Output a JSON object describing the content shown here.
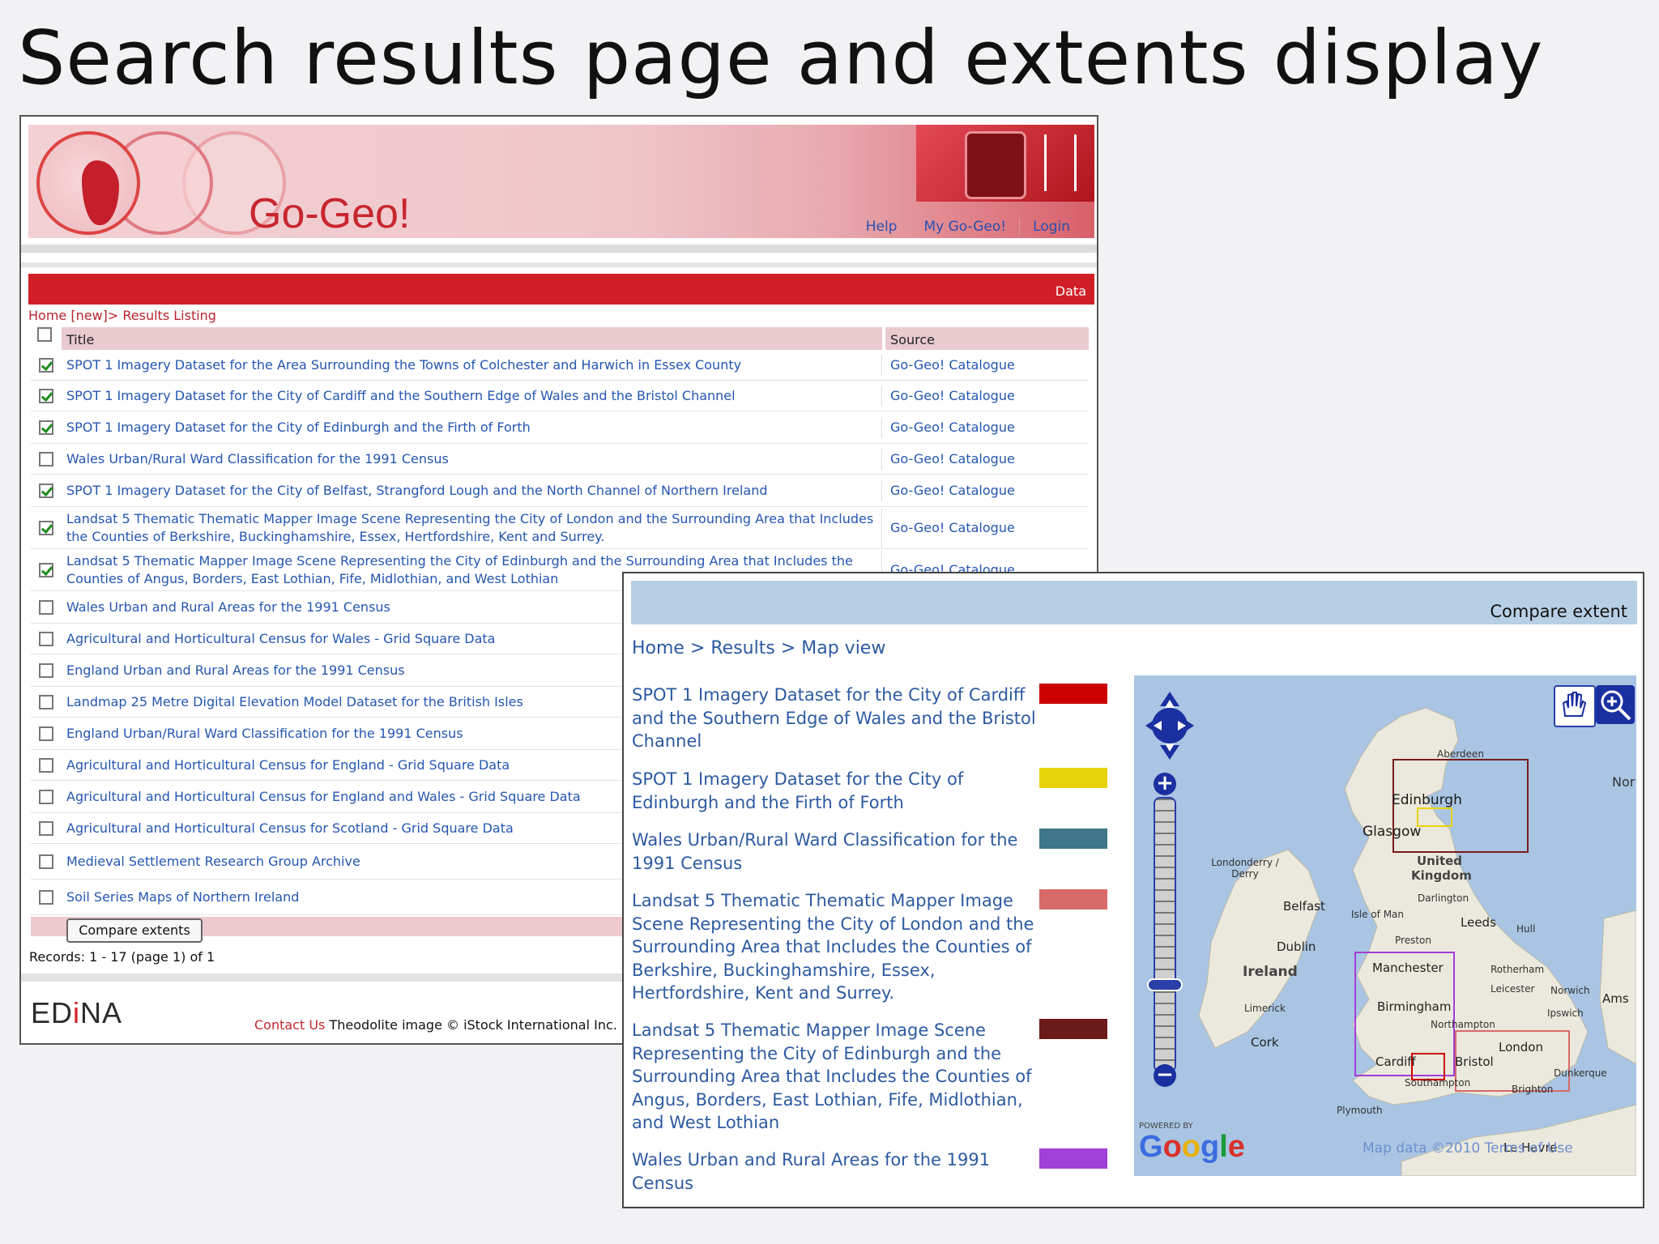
{
  "slide_title": "Search results page and extents display",
  "results_page": {
    "logo": "Go-Geo!",
    "nav": [
      "Help",
      "My Go-Geo!",
      "Login"
    ],
    "section_label": "Data",
    "breadcrumb": "Home [new]> Results Listing",
    "columns": {
      "title": "Title",
      "source": "Source"
    },
    "rows": [
      {
        "checked": true,
        "title": "SPOT 1 Imagery Dataset for the Area Surrounding the Towns of Colchester and Harwich in Essex County",
        "source": "Go-Geo! Catalogue"
      },
      {
        "checked": true,
        "title": "SPOT 1 Imagery Dataset for the City of Cardiff and the Southern Edge of Wales and the Bristol Channel",
        "source": "Go-Geo! Catalogue"
      },
      {
        "checked": true,
        "title": "SPOT 1 Imagery Dataset for the City of Edinburgh and the Firth of Forth",
        "source": "Go-Geo! Catalogue"
      },
      {
        "checked": false,
        "title": "Wales Urban/Rural Ward Classification for the 1991 Census",
        "source": "Go-Geo! Catalogue"
      },
      {
        "checked": true,
        "title": "SPOT 1 Imagery Dataset for the City of Belfast, Strangford Lough and the North Channel of Northern Ireland",
        "source": "Go-Geo! Catalogue"
      },
      {
        "checked": true,
        "title": "Landsat 5 Thematic Thematic Mapper Image Scene Representing the City of London and the Surrounding Area that Includes the Counties of Berkshire, Buckinghamshire, Essex, Hertfordshire, Kent and Surrey.",
        "source": "Go-Geo! Catalogue"
      },
      {
        "checked": true,
        "title": "Landsat 5 Thematic Mapper Image Scene Representing the City of Edinburgh and the Surrounding Area that Includes the Counties of Angus, Borders, East Lothian, Fife, Midlothian, and West Lothian",
        "source": "Go-Geo! Catalogue"
      },
      {
        "checked": false,
        "title": "Wales Urban and Rural Areas for the 1991 Census",
        "source": ""
      },
      {
        "checked": false,
        "title": "Agricultural and Horticultural Census for Wales - Grid Square Data",
        "source": ""
      },
      {
        "checked": false,
        "title": "England Urban and Rural Areas for the 1991 Census",
        "source": ""
      },
      {
        "checked": false,
        "title": "Landmap 25 Metre Digital Elevation Model Dataset for the British Isles",
        "source": ""
      },
      {
        "checked": false,
        "title": "England Urban/Rural Ward Classification for the 1991 Census",
        "source": ""
      },
      {
        "checked": false,
        "title": "Agricultural and Horticultural Census for England - Grid Square Data",
        "source": ""
      },
      {
        "checked": false,
        "title": "Agricultural and Horticultural Census for England and Wales - Grid Square Data",
        "source": ""
      },
      {
        "checked": false,
        "title": "Agricultural and Horticultural Census for Scotland - Grid Square Data",
        "source": ""
      },
      {
        "checked": false,
        "title": "Medieval Settlement Research Group Archive",
        "source": ""
      },
      {
        "checked": false,
        "title": "Soil Series Maps of Northern Ireland",
        "source": ""
      }
    ],
    "compare_button": "Compare extents",
    "records": "Records: 1 - 17 (page 1) of 1",
    "footer_logo": "EDINA",
    "contact_link": "Contact Us",
    "credit": "Theodolite image © iStock International Inc."
  },
  "compare_page": {
    "header": "Compare extent",
    "breadcrumb": "Home > Results > Map view",
    "legend": [
      {
        "label": "SPOT 1 Imagery Dataset for the City of Cardiff and the Southern Edge of Wales and the Bristol Channel",
        "color": "#cc0000"
      },
      {
        "label": "SPOT 1 Imagery Dataset for the City of Edinburgh and the Firth of Forth",
        "color": "#e8d40c"
      },
      {
        "label": "Wales Urban/Rural Ward Classification for the 1991 Census",
        "color": "#3f7688"
      },
      {
        "label": "Landsat 5 Thematic Thematic Mapper Image Scene Representing the City of London and the Surrounding Area that Includes the Counties of Berkshire, Buckinghamshire, Essex, Hertfordshire, Kent and Surrey.",
        "color": "#d86a6a"
      },
      {
        "label": "Landsat 5 Thematic Mapper Image Scene Representing the City of Edinburgh and the Surrounding Area that Includes the Counties of Angus, Borders, East Lothian, Fife, Midlothian, and West Lothian",
        "color": "#6b1a1a"
      },
      {
        "label": "Wales Urban and Rural Areas for the 1991 Census",
        "color": "#a040d8"
      }
    ],
    "map": {
      "labels": {
        "aberdeen": "Aberdeen",
        "edinburgh": "Edinburgh",
        "glasgow": "Glasgow",
        "united_kingdom": "United Kingdom",
        "londonderry": "Londonderry / Derry",
        "darlington": "Darlington",
        "belfast": "Belfast",
        "isle_of_man": "Isle of Man",
        "leeds": "Leeds",
        "hull": "Hull",
        "preston": "Preston",
        "dublin": "Dublin",
        "ireland": "Ireland",
        "manchester": "Manchester",
        "rotherham": "Rotherham",
        "leicester": "Leicester",
        "norwich": "Norwich",
        "limerick": "Limerick",
        "birmingham": "Birmingham",
        "ipswich": "Ipswich",
        "cork": "Cork",
        "northampton": "Northampton",
        "london": "London",
        "cardiff": "Cardiff",
        "bristol": "Bristol",
        "dunkerque": "Dunkerque",
        "southampton": "Southampton",
        "brighton": "Brighton",
        "plymouth": "Plymouth",
        "le_havre": "Le Havre",
        "nor": "Nor",
        "ams": "Ams"
      },
      "powered_by": "POWERED BY",
      "google": "Google",
      "map_data": "Map data ©2010",
      "terms": "Terms of Use",
      "tools": [
        "pan-hand",
        "zoom-box"
      ]
    }
  }
}
